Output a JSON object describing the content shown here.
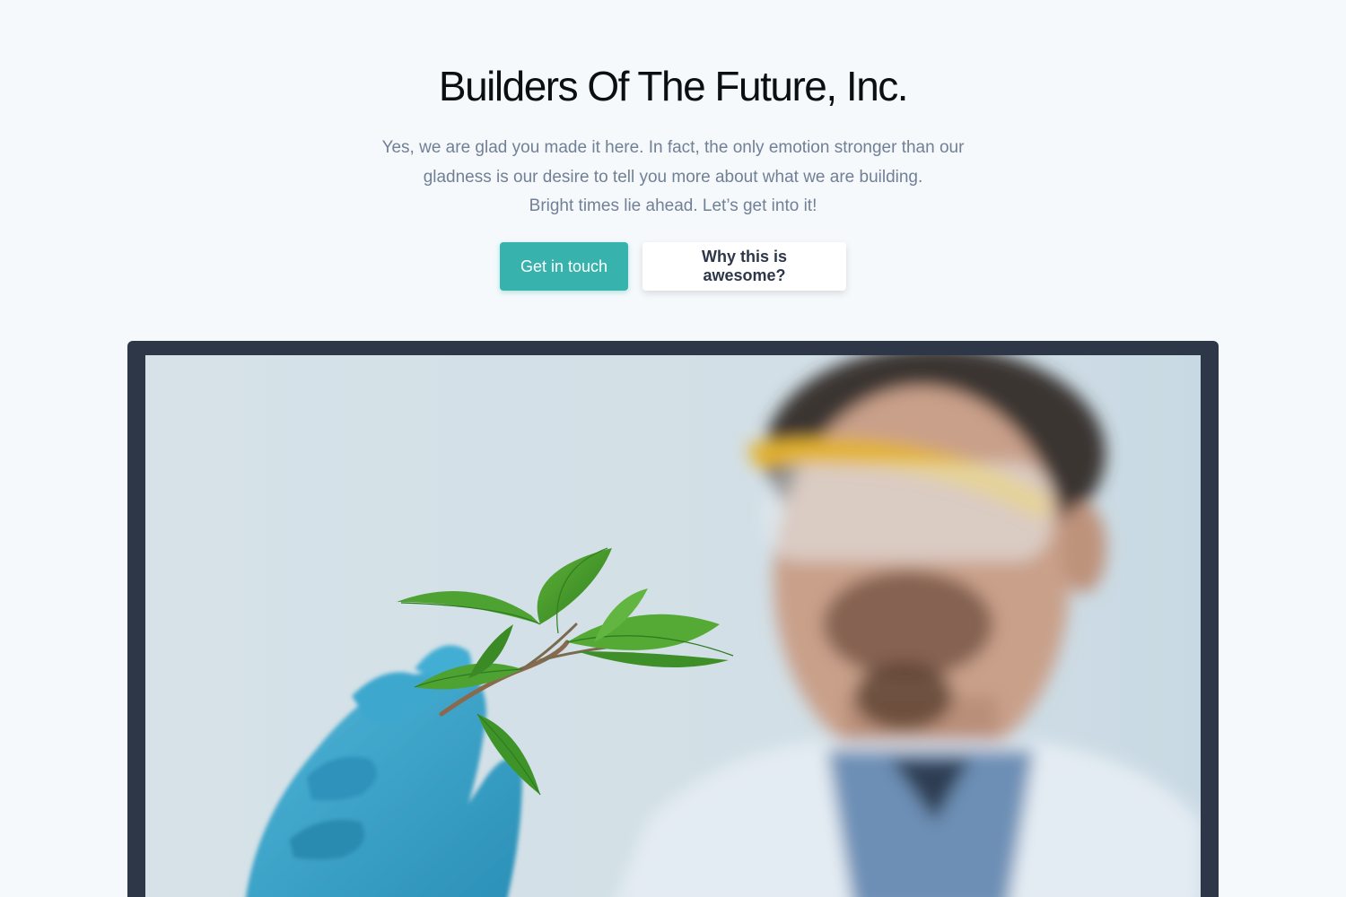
{
  "hero": {
    "title": "Builders Of The Future, Inc.",
    "subtitle_lines": [
      "Yes, we are glad you made it here. In fact, the only emotion stronger than our",
      "gladness is our desire to tell you more about what we are building.",
      "Bright times lie ahead. Let’s get into it!"
    ],
    "primary_button": "Get in touch",
    "secondary_button": "Why this is awesome?"
  },
  "colors": {
    "background": "#f5f9fc",
    "accent": "#38b2ac",
    "frame": "#2d3748",
    "text_muted": "#718096",
    "heading": "#0b0f14"
  },
  "photo": {
    "subject": "scientist-holding-plant"
  }
}
